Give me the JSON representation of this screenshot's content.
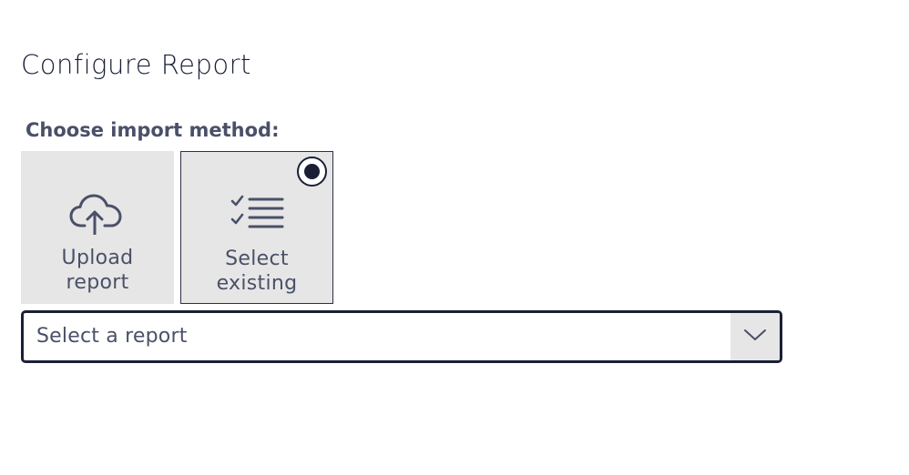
{
  "page": {
    "title": "Configure Report"
  },
  "import_method": {
    "label": "Choose import method:",
    "selected": "existing",
    "options": [
      {
        "id": "upload",
        "icon": "cloud-upload-icon",
        "label_line1": "Upload",
        "label_line2": "report",
        "selected": false
      },
      {
        "id": "existing",
        "icon": "checklist-icon",
        "label_line1": "Select",
        "label_line2": "existing",
        "selected": true
      }
    ]
  },
  "report_select": {
    "value": "Select a report",
    "icon": "chevron-down-icon"
  },
  "colors": {
    "text_dark": "#1a1f36",
    "text_muted": "#4a5068",
    "tile_bg": "#e6e6e6"
  }
}
